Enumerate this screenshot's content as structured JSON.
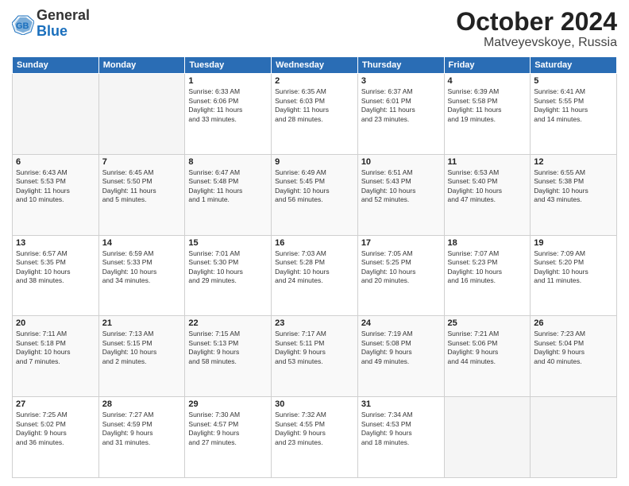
{
  "header": {
    "logo_general": "General",
    "logo_blue": "Blue",
    "month_title": "October 2024",
    "location": "Matveyevskoye, Russia"
  },
  "weekdays": [
    "Sunday",
    "Monday",
    "Tuesday",
    "Wednesday",
    "Thursday",
    "Friday",
    "Saturday"
  ],
  "weeks": [
    [
      {
        "day": "",
        "info": ""
      },
      {
        "day": "",
        "info": ""
      },
      {
        "day": "1",
        "info": "Sunrise: 6:33 AM\nSunset: 6:06 PM\nDaylight: 11 hours\nand 33 minutes."
      },
      {
        "day": "2",
        "info": "Sunrise: 6:35 AM\nSunset: 6:03 PM\nDaylight: 11 hours\nand 28 minutes."
      },
      {
        "day": "3",
        "info": "Sunrise: 6:37 AM\nSunset: 6:01 PM\nDaylight: 11 hours\nand 23 minutes."
      },
      {
        "day": "4",
        "info": "Sunrise: 6:39 AM\nSunset: 5:58 PM\nDaylight: 11 hours\nand 19 minutes."
      },
      {
        "day": "5",
        "info": "Sunrise: 6:41 AM\nSunset: 5:55 PM\nDaylight: 11 hours\nand 14 minutes."
      }
    ],
    [
      {
        "day": "6",
        "info": "Sunrise: 6:43 AM\nSunset: 5:53 PM\nDaylight: 11 hours\nand 10 minutes."
      },
      {
        "day": "7",
        "info": "Sunrise: 6:45 AM\nSunset: 5:50 PM\nDaylight: 11 hours\nand 5 minutes."
      },
      {
        "day": "8",
        "info": "Sunrise: 6:47 AM\nSunset: 5:48 PM\nDaylight: 11 hours\nand 1 minute."
      },
      {
        "day": "9",
        "info": "Sunrise: 6:49 AM\nSunset: 5:45 PM\nDaylight: 10 hours\nand 56 minutes."
      },
      {
        "day": "10",
        "info": "Sunrise: 6:51 AM\nSunset: 5:43 PM\nDaylight: 10 hours\nand 52 minutes."
      },
      {
        "day": "11",
        "info": "Sunrise: 6:53 AM\nSunset: 5:40 PM\nDaylight: 10 hours\nand 47 minutes."
      },
      {
        "day": "12",
        "info": "Sunrise: 6:55 AM\nSunset: 5:38 PM\nDaylight: 10 hours\nand 43 minutes."
      }
    ],
    [
      {
        "day": "13",
        "info": "Sunrise: 6:57 AM\nSunset: 5:35 PM\nDaylight: 10 hours\nand 38 minutes."
      },
      {
        "day": "14",
        "info": "Sunrise: 6:59 AM\nSunset: 5:33 PM\nDaylight: 10 hours\nand 34 minutes."
      },
      {
        "day": "15",
        "info": "Sunrise: 7:01 AM\nSunset: 5:30 PM\nDaylight: 10 hours\nand 29 minutes."
      },
      {
        "day": "16",
        "info": "Sunrise: 7:03 AM\nSunset: 5:28 PM\nDaylight: 10 hours\nand 24 minutes."
      },
      {
        "day": "17",
        "info": "Sunrise: 7:05 AM\nSunset: 5:25 PM\nDaylight: 10 hours\nand 20 minutes."
      },
      {
        "day": "18",
        "info": "Sunrise: 7:07 AM\nSunset: 5:23 PM\nDaylight: 10 hours\nand 16 minutes."
      },
      {
        "day": "19",
        "info": "Sunrise: 7:09 AM\nSunset: 5:20 PM\nDaylight: 10 hours\nand 11 minutes."
      }
    ],
    [
      {
        "day": "20",
        "info": "Sunrise: 7:11 AM\nSunset: 5:18 PM\nDaylight: 10 hours\nand 7 minutes."
      },
      {
        "day": "21",
        "info": "Sunrise: 7:13 AM\nSunset: 5:15 PM\nDaylight: 10 hours\nand 2 minutes."
      },
      {
        "day": "22",
        "info": "Sunrise: 7:15 AM\nSunset: 5:13 PM\nDaylight: 9 hours\nand 58 minutes."
      },
      {
        "day": "23",
        "info": "Sunrise: 7:17 AM\nSunset: 5:11 PM\nDaylight: 9 hours\nand 53 minutes."
      },
      {
        "day": "24",
        "info": "Sunrise: 7:19 AM\nSunset: 5:08 PM\nDaylight: 9 hours\nand 49 minutes."
      },
      {
        "day": "25",
        "info": "Sunrise: 7:21 AM\nSunset: 5:06 PM\nDaylight: 9 hours\nand 44 minutes."
      },
      {
        "day": "26",
        "info": "Sunrise: 7:23 AM\nSunset: 5:04 PM\nDaylight: 9 hours\nand 40 minutes."
      }
    ],
    [
      {
        "day": "27",
        "info": "Sunrise: 7:25 AM\nSunset: 5:02 PM\nDaylight: 9 hours\nand 36 minutes."
      },
      {
        "day": "28",
        "info": "Sunrise: 7:27 AM\nSunset: 4:59 PM\nDaylight: 9 hours\nand 31 minutes."
      },
      {
        "day": "29",
        "info": "Sunrise: 7:30 AM\nSunset: 4:57 PM\nDaylight: 9 hours\nand 27 minutes."
      },
      {
        "day": "30",
        "info": "Sunrise: 7:32 AM\nSunset: 4:55 PM\nDaylight: 9 hours\nand 23 minutes."
      },
      {
        "day": "31",
        "info": "Sunrise: 7:34 AM\nSunset: 4:53 PM\nDaylight: 9 hours\nand 18 minutes."
      },
      {
        "day": "",
        "info": ""
      },
      {
        "day": "",
        "info": ""
      }
    ]
  ]
}
